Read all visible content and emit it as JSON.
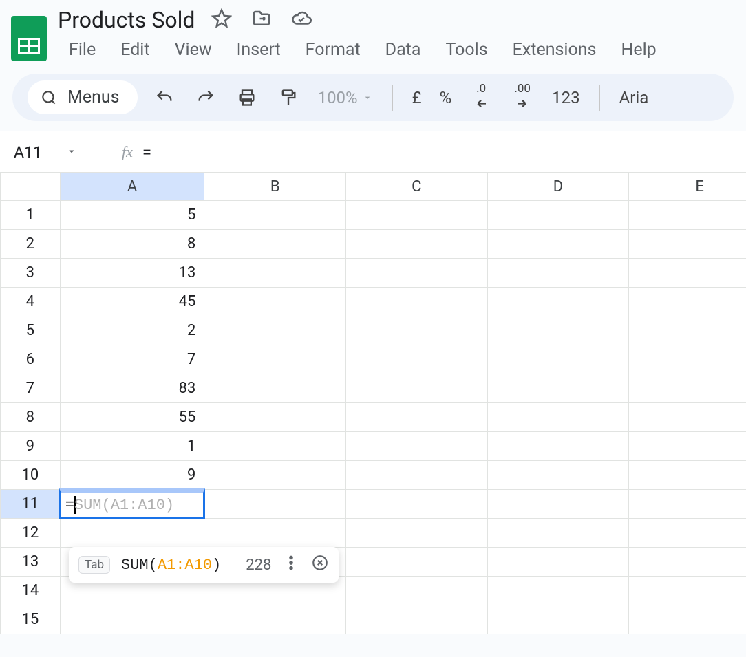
{
  "doc": {
    "title": "Products Sold"
  },
  "menubar": {
    "items": [
      "File",
      "Edit",
      "View",
      "Insert",
      "Format",
      "Data",
      "Tools",
      "Extensions",
      "Help"
    ]
  },
  "toolbar": {
    "search_label": "Menus",
    "zoom": "100%",
    "currency": "£",
    "percent": "%",
    "dec_dec": ".0",
    "inc_dec": ".00",
    "numfmt": "123",
    "font": "Aria"
  },
  "namebar": {
    "cell_ref": "A11",
    "fx_label": "fx",
    "formula": "="
  },
  "grid": {
    "columns": [
      "A",
      "B",
      "C",
      "D",
      "E"
    ],
    "active_col": "A",
    "active_row": 11,
    "rows": [
      {
        "n": 1,
        "A": "5"
      },
      {
        "n": 2,
        "A": "8"
      },
      {
        "n": 3,
        "A": "13"
      },
      {
        "n": 4,
        "A": "45"
      },
      {
        "n": 5,
        "A": "2"
      },
      {
        "n": 6,
        "A": "7"
      },
      {
        "n": 7,
        "A": "83"
      },
      {
        "n": 8,
        "A": "55"
      },
      {
        "n": 9,
        "A": "1"
      },
      {
        "n": 10,
        "A": "9"
      },
      {
        "n": 11,
        "A_editing": {
          "eq": "=",
          "ghost": "SUM(A1:A10)"
        }
      },
      {
        "n": 12
      },
      {
        "n": 13
      },
      {
        "n": 14
      },
      {
        "n": 15
      }
    ]
  },
  "suggestion": {
    "tab_hint": "Tab",
    "func": "SUM",
    "open": "(",
    "range": "A1:A10",
    "close": ")",
    "result": "228"
  }
}
